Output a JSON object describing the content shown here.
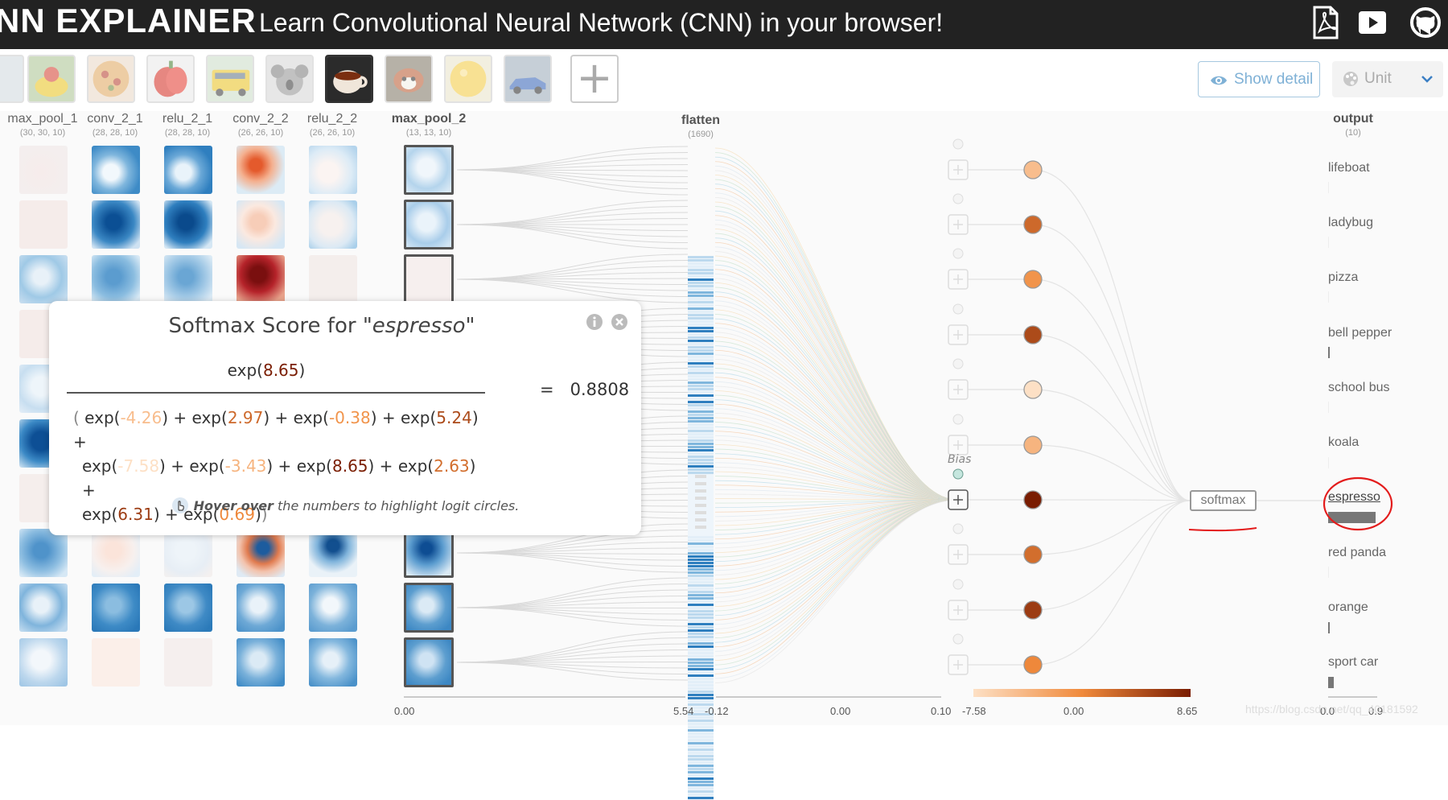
{
  "header": {
    "title": "NN EXPLAINER",
    "subtitle": "Learn Convolutional Neural Network (CNN) in your browser!",
    "icons": [
      "pdf-icon",
      "video-icon",
      "github-icon"
    ]
  },
  "toolbar": {
    "thumbnails": [
      "partial",
      "boat",
      "pizza",
      "bell pepper",
      "school bus",
      "koala",
      "espresso",
      "red panda",
      "orange",
      "sport car"
    ],
    "selected_thumbnail": "espresso",
    "add_label": "+",
    "show_detail_label": "Show detail",
    "unit_label": "Unit"
  },
  "layers": {
    "max_pool_1": {
      "name": "max_pool_1",
      "dim": "(30, 30, 10)"
    },
    "conv_2_1": {
      "name": "conv_2_1",
      "dim": "(28, 28, 10)"
    },
    "relu_2_1": {
      "name": "relu_2_1",
      "dim": "(28, 28, 10)"
    },
    "conv_2_2": {
      "name": "conv_2_2",
      "dim": "(26, 26, 10)"
    },
    "relu_2_2": {
      "name": "relu_2_2",
      "dim": "(26, 26, 10)"
    },
    "max_pool_2": {
      "name": "max_pool_2",
      "dim": "(13, 13, 10)"
    },
    "flatten": {
      "name": "flatten",
      "dim": "(1690)"
    },
    "output": {
      "name": "output",
      "dim": "(10)"
    }
  },
  "output_classes": [
    {
      "label": "lifeboat",
      "prob": 0.0
    },
    {
      "label": "ladybug",
      "prob": 0.0
    },
    {
      "label": "pizza",
      "prob": 0.0
    },
    {
      "label": "bell pepper",
      "prob": 0.003
    },
    {
      "label": "school bus",
      "prob": 0.0
    },
    {
      "label": "koala",
      "prob": 0.0
    },
    {
      "label": "espresso",
      "prob": 0.8808
    },
    {
      "label": "red panda",
      "prob": 0.0
    },
    {
      "label": "orange",
      "prob": 0.012
    },
    {
      "label": "sport car",
      "prob": 0.1
    }
  ],
  "logits": [
    -4.26,
    2.97,
    -0.38,
    5.24,
    -7.58,
    -3.43,
    8.65,
    2.63,
    6.31,
    0.69
  ],
  "softmax_label": "softmax",
  "bias_label": "Bias",
  "scales": {
    "pool_min": "0.00",
    "pool_max": "5.54",
    "weight_min": "-0.12",
    "weight_mid": "0.00",
    "weight_max": "0.10",
    "logit_min": "-7.58",
    "logit_mid": "0.00",
    "logit_max": "8.65",
    "prob_min": "0.0",
    "prob_max": "0.9"
  },
  "popup": {
    "title_prefix": "Softmax Score for \"",
    "title_class": "espresso",
    "title_suffix": "\"",
    "numerator_value": "8.65",
    "result": "0.8808",
    "hint_bold": "Hover over",
    "hint_rest": " the numbers to highlight logit circles."
  },
  "watermark": "https://blog.csdn.net/qq_40181592",
  "colors": {
    "header_bg": "#222222",
    "accent_blue": "#7fb1d6",
    "annotation_red": "#e31b1b"
  }
}
